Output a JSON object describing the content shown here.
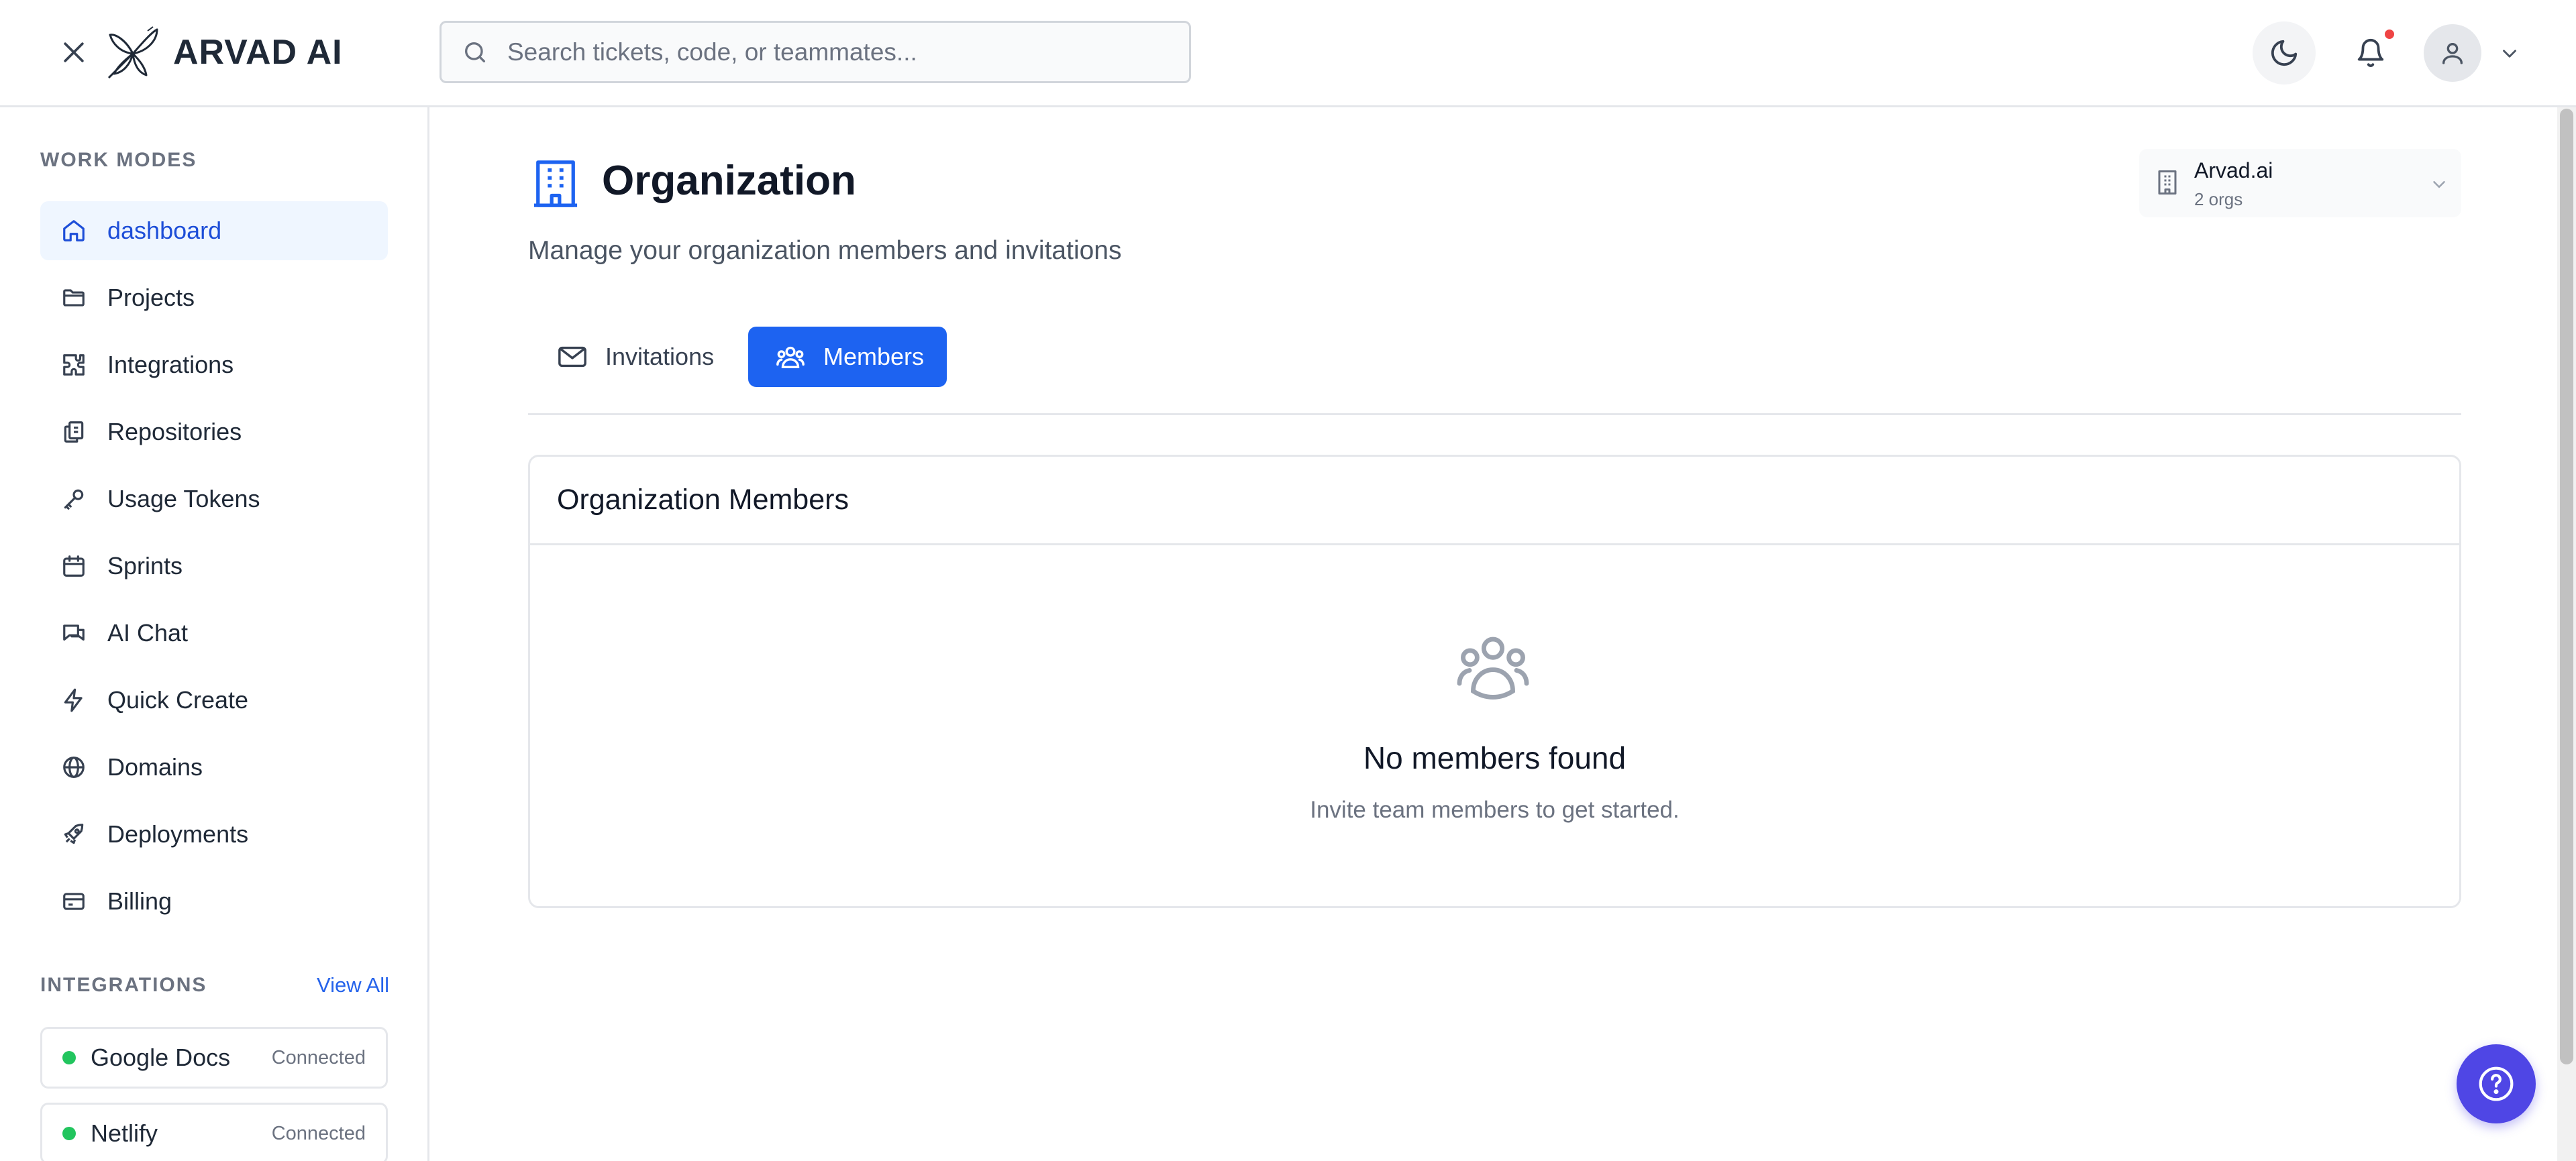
{
  "header": {
    "brand": "ARVAD AI",
    "search_placeholder": "Search tickets, code, or teammates...",
    "notification_dot_color": "#ef4444"
  },
  "sidebar": {
    "work_modes_label": "WORK MODES",
    "items": [
      {
        "label": "dashboard",
        "icon": "home-icon",
        "active": true
      },
      {
        "label": "Projects",
        "icon": "folder-icon"
      },
      {
        "label": "Integrations",
        "icon": "puzzle-icon"
      },
      {
        "label": "Repositories",
        "icon": "repository-icon"
      },
      {
        "label": "Usage Tokens",
        "icon": "key-icon"
      },
      {
        "label": "Sprints",
        "icon": "calendar-icon"
      },
      {
        "label": "AI Chat",
        "icon": "chat-icon"
      },
      {
        "label": "Quick Create",
        "icon": "lightning-icon"
      },
      {
        "label": "Domains",
        "icon": "globe-icon"
      },
      {
        "label": "Deployments",
        "icon": "rocket-icon"
      },
      {
        "label": "Billing",
        "icon": "credit-card-icon"
      }
    ],
    "integrations_label": "INTEGRATIONS",
    "view_all": "View All",
    "integrations": [
      {
        "name": "Google Docs",
        "status": "Connected"
      },
      {
        "name": "Netlify",
        "status": "Connected"
      }
    ]
  },
  "main": {
    "title": "Organization",
    "subtitle": "Manage your organization members and invitations",
    "org_switcher": {
      "name": "Arvad.ai",
      "count": "2 orgs"
    },
    "tabs": [
      {
        "label": "Invitations",
        "icon": "mail-icon",
        "active": false
      },
      {
        "label": "Members",
        "icon": "users-icon",
        "active": true
      }
    ],
    "card": {
      "title": "Organization Members",
      "empty_title": "No members found",
      "empty_subtitle": "Invite team members to get started."
    }
  },
  "colors": {
    "accent": "#1d63f1",
    "help_button": "#4f46e5",
    "connected": "#22c55e"
  }
}
